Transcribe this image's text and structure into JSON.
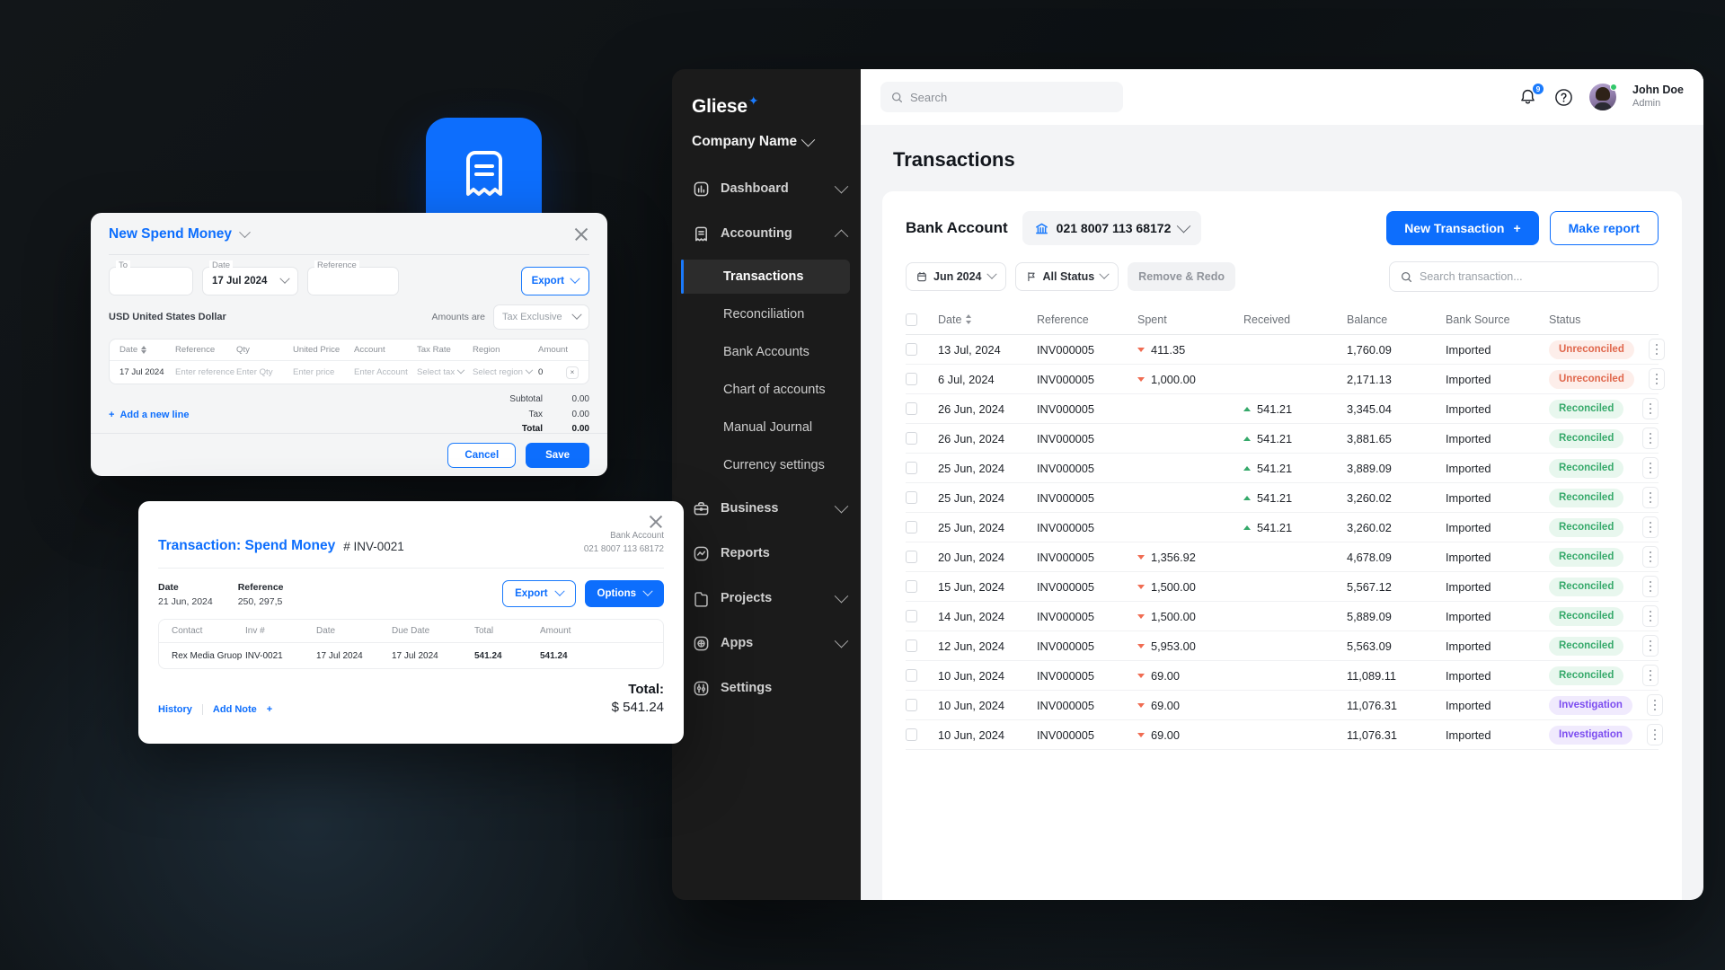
{
  "sidebar": {
    "brand": "Gliese",
    "brand_spark_icon": "sparkle-icon",
    "company": "Company Name",
    "items": [
      {
        "label": "Dashboard",
        "icon": "dashboard-icon",
        "expand": "chevron-down-icon"
      },
      {
        "label": "Accounting",
        "icon": "receipt-icon",
        "expand": "chevron-up-icon"
      }
    ],
    "accounting_children": [
      {
        "label": "Transactions",
        "active": true
      },
      {
        "label": "Reconciliation",
        "active": false
      },
      {
        "label": "Bank Accounts",
        "active": false
      },
      {
        "label": "Chart of accounts",
        "active": false
      },
      {
        "label": "Manual Journal",
        "active": false
      },
      {
        "label": "Currency settings",
        "active": false
      }
    ],
    "items_lower": [
      {
        "label": "Business",
        "icon": "briefcase-icon",
        "expand": "chevron-down-icon"
      },
      {
        "label": "Reports",
        "icon": "chart-line-icon",
        "expand": ""
      },
      {
        "label": "Projects",
        "icon": "folder-icon",
        "expand": "chevron-down-icon"
      },
      {
        "label": "Apps",
        "icon": "grid-icon",
        "expand": "chevron-down-icon"
      },
      {
        "label": "Settings",
        "icon": "sliders-icon",
        "expand": ""
      }
    ]
  },
  "topbar": {
    "search_placeholder": "Search",
    "search_icon": "search-icon",
    "bell_icon": "bell-icon",
    "notification_count": "9",
    "help_icon": "question-circle-icon",
    "user_name": "John Doe",
    "user_role": "Admin"
  },
  "page": {
    "title": "Transactions",
    "bank_account_label": "Bank Account",
    "bank_account_value": "021 8007 113 68172",
    "bank_icon": "bank-icon",
    "new_transaction_label": "New Transaction",
    "new_transaction_plus": "+",
    "make_report_label": "Make report",
    "filter_period": "Jun 2024",
    "filter_status": "All Status",
    "filter_remove_redo": "Remove & Redo",
    "calendar_icon": "calendar-icon",
    "flag_icon": "flag-icon",
    "search_transaction_placeholder": "Search transaction..."
  },
  "table": {
    "headers": [
      "Date",
      "Reference",
      "Spent",
      "Received",
      "Balance",
      "Bank  Source",
      "Status"
    ],
    "rows": [
      {
        "date": "13 Jul, 2024",
        "reference": "INV000005",
        "spent": "411.35",
        "received": "",
        "balance": "1,760.09",
        "bank": "Imported",
        "status": "Unreconciled",
        "status_kind": "unrec"
      },
      {
        "date": "6 Jul, 2024",
        "reference": "INV000005",
        "spent": "1,000.00",
        "received": "",
        "balance": "2,171.13",
        "bank": "Imported",
        "status": "Unreconciled",
        "status_kind": "unrec"
      },
      {
        "date": "26 Jun, 2024",
        "reference": "INV000005",
        "spent": "",
        "received": "541.21",
        "balance": "3,345.04",
        "bank": "Imported",
        "status": "Reconciled",
        "status_kind": "rec"
      },
      {
        "date": "26 Jun, 2024",
        "reference": "INV000005",
        "spent": "",
        "received": "541.21",
        "balance": "3,881.65",
        "bank": "Imported",
        "status": "Reconciled",
        "status_kind": "rec"
      },
      {
        "date": "25 Jun, 2024",
        "reference": "INV000005",
        "spent": "",
        "received": "541.21",
        "balance": "3,889.09",
        "bank": "Imported",
        "status": "Reconciled",
        "status_kind": "rec"
      },
      {
        "date": "25 Jun, 2024",
        "reference": "INV000005",
        "spent": "",
        "received": "541.21",
        "balance": "3,260.02",
        "bank": "Imported",
        "status": "Reconciled",
        "status_kind": "rec"
      },
      {
        "date": "25 Jun, 2024",
        "reference": "INV000005",
        "spent": "",
        "received": "541.21",
        "balance": "3,260.02",
        "bank": "Imported",
        "status": "Reconciled",
        "status_kind": "rec"
      },
      {
        "date": "20 Jun, 2024",
        "reference": "INV000005",
        "spent": "1,356.92",
        "received": "",
        "balance": "4,678.09",
        "bank": "Imported",
        "status": "Reconciled",
        "status_kind": "rec"
      },
      {
        "date": "15 Jun, 2024",
        "reference": "INV000005",
        "spent": "1,500.00",
        "received": "",
        "balance": "5,567.12",
        "bank": "Imported",
        "status": "Reconciled",
        "status_kind": "rec"
      },
      {
        "date": "14 Jun, 2024",
        "reference": "INV000005",
        "spent": "1,500.00",
        "received": "",
        "balance": "5,889.09",
        "bank": "Imported",
        "status": "Reconciled",
        "status_kind": "rec"
      },
      {
        "date": "12 Jun, 2024",
        "reference": "INV000005",
        "spent": "5,953.00",
        "received": "",
        "balance": "5,563.09",
        "bank": "Imported",
        "status": "Reconciled",
        "status_kind": "rec"
      },
      {
        "date": "10 Jun, 2024",
        "reference": "INV000005",
        "spent": "69.00",
        "received": "",
        "balance": "11,089.11",
        "bank": "Imported",
        "status": "Reconciled",
        "status_kind": "rec"
      },
      {
        "date": "10 Jun, 2024",
        "reference": "INV000005",
        "spent": "69.00",
        "received": "",
        "balance": "11,076.31",
        "bank": "Imported",
        "status": "Investigation",
        "status_kind": "inv"
      },
      {
        "date": "10 Jun, 2024",
        "reference": "INV000005",
        "spent": "69.00",
        "received": "",
        "balance": "11,076.31",
        "bank": "Imported",
        "status": "Investigation",
        "status_kind": "inv"
      }
    ]
  },
  "modal_spend": {
    "title": "New Spend Money",
    "close_icon": "close-icon",
    "field_to_label": "To",
    "field_to_value": "",
    "field_date_label": "Date",
    "field_date_value": "17 Jul 2024",
    "field_reference_label": "Reference",
    "field_reference_value": "",
    "export_label": "Export",
    "currency": "USD United States Dollar",
    "amounts_are_label": "Amounts are",
    "amounts_are_value": "Tax Exclusive",
    "headers": [
      "Date",
      "Reference",
      "Qty",
      "United Price",
      "Account",
      "Tax Rate",
      "Region",
      "Amount"
    ],
    "row": {
      "date": "17 Jul 2024",
      "reference_ph": "Enter reference",
      "qty_ph": "Enter Qty",
      "price_ph": "Enter price",
      "account_ph": "Enter Account",
      "tax_ph": "Select tax",
      "region_ph": "Select region",
      "amount": "0"
    },
    "add_line_label": "Add a new line",
    "add_line_plus": "+",
    "subtotal_label": "Subtotal",
    "subtotal_value": "0.00",
    "tax_label": "Tax",
    "tax_value": "0.00",
    "total_label": "Total",
    "total_value": "0.00",
    "cancel_label": "Cancel",
    "save_label": "Save"
  },
  "modal_transaction": {
    "title": "Transaction: Spend Money",
    "number": "# INV-0021",
    "bank_account_label": "Bank Account",
    "bank_account_value": "021 8007 113 68172",
    "date_label": "Date",
    "date_value": "21 Jun, 2024",
    "reference_label": "Reference",
    "reference_value": "250, 297,5",
    "export_label": "Export",
    "options_label": "Options",
    "headers": [
      "Contact",
      "Inv #",
      "Date",
      "Due Date",
      "Total",
      "Amount"
    ],
    "row": {
      "contact": "Rex Media Gruop",
      "inv": "INV-0021",
      "date": "17 Jul 2024",
      "due_date": "17 Jul 2024",
      "total": "541.24",
      "amount": "541.24"
    },
    "history_label": "History",
    "add_note_label": "Add Note",
    "add_note_plus": "+",
    "total_label": "Total:",
    "total_value": "$ 541.24"
  },
  "float_icon": {
    "name": "receipt-app-icon",
    "color": "#0d6efd"
  }
}
